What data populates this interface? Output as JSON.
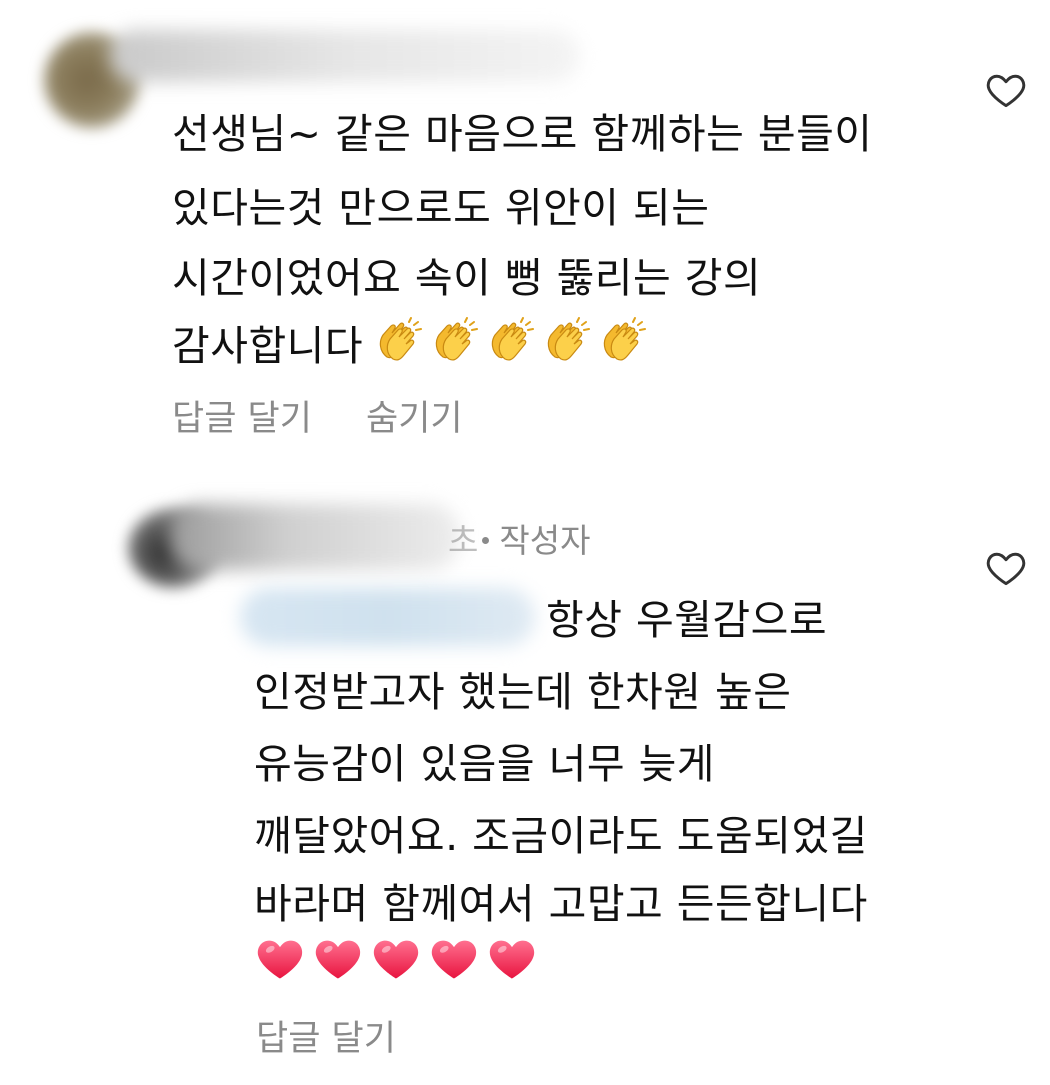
{
  "comments": [
    {
      "lines": [
        "선생님~ 같은 마음으로 함께하는 분들이",
        "있다는것 만으로도 위안이 되는",
        "시간이었어요 속이 뻥 뚫리는 강의",
        "감사합니다"
      ],
      "emoji_icon": "clapping-hands-icon",
      "emoji_count": 5,
      "actions": {
        "reply": "답글 달기",
        "hide": "숨기기"
      }
    },
    {
      "meta_suffix": "초",
      "author_badge": "작성자",
      "lines": [
        "항상 우월감으로",
        "인정받고자 했는데 한차원 높은",
        "유능감이 있음을 너무 늦게",
        "깨달았어요. 조금이라도 도움되었길",
        "바라며 함께여서 고맙고 든든합니다"
      ],
      "emoji_icon": "red-heart-icon",
      "emoji_count": 5,
      "actions": {
        "reply": "답글 달기"
      }
    }
  ],
  "colors": {
    "text": "#111111",
    "secondary": "#8a8a8a",
    "heart_outline": "#333333",
    "emoji_heart": "#ff2a5a",
    "emoji_clap": "#f6c333"
  }
}
